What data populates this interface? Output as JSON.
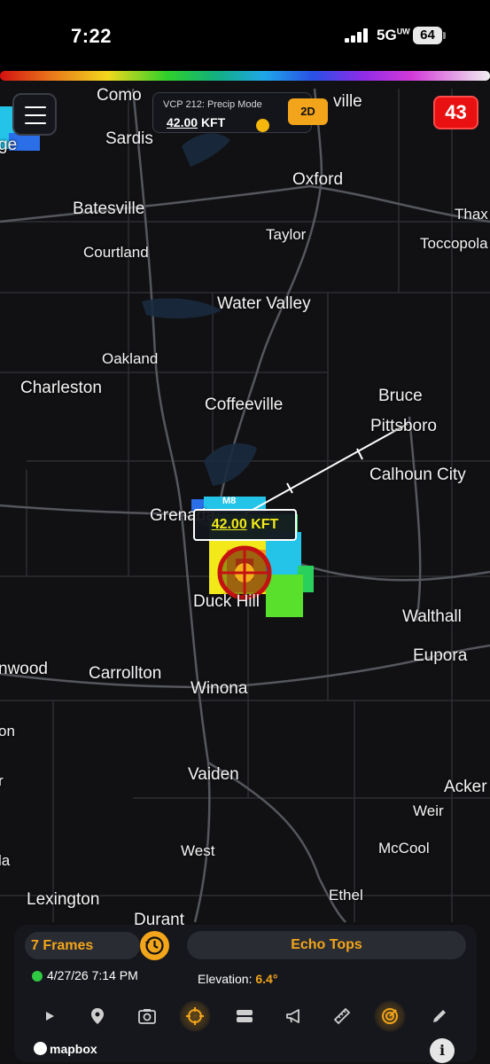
{
  "status_bar": {
    "time": "7:22",
    "network": "5G",
    "network_sup": "UW",
    "battery": "64"
  },
  "header": {
    "vcp_title": "VCP 212: Precip Mode",
    "vcp_value": "42.00",
    "vcp_unit": "KFT",
    "mode_label": "2D",
    "alert_count": "43"
  },
  "map": {
    "places": [
      "Como",
      "ville",
      "Sardis",
      "ge",
      "Oxford",
      "Batesville",
      "Thax",
      "Taylor",
      "Courtland",
      "Toccopola",
      "Water Valley",
      "Oakland",
      "Charleston",
      "Coffeeville",
      "Bruce",
      "Pittsboro",
      "Calhoun City",
      "Grenada",
      "Duck Hill",
      "Walthall",
      "Eupora",
      "nwood",
      "Carrollton",
      "Winona",
      "on",
      "Vaiden",
      "Acker",
      "r",
      "Weir",
      "West",
      "McCool",
      "la",
      "Lexington",
      "Ethel",
      "Durant"
    ],
    "storm_label": "M8",
    "echo_value": "42.00",
    "echo_unit": "KFT"
  },
  "panel": {
    "frames_label": "7 Frames",
    "product_label": "Echo Tops",
    "timestamp": "4/27/26 7:14 PM",
    "elevation_label": "Elevation:",
    "elevation_value": "6.4°"
  },
  "toolbar_icons": [
    "play-icon",
    "location-pin-icon",
    "screenshot-icon",
    "crosshair-icon",
    "layers-icon",
    "megaphone-icon",
    "ruler-icon",
    "radar-icon",
    "pencil-icon"
  ],
  "footer": {
    "mapbox": "mapbox",
    "info": "i"
  },
  "colors": {
    "accent": "#f2a51a",
    "alert": "#e81010",
    "live": "#2fc943",
    "echo_text": "#f2ea1a"
  }
}
